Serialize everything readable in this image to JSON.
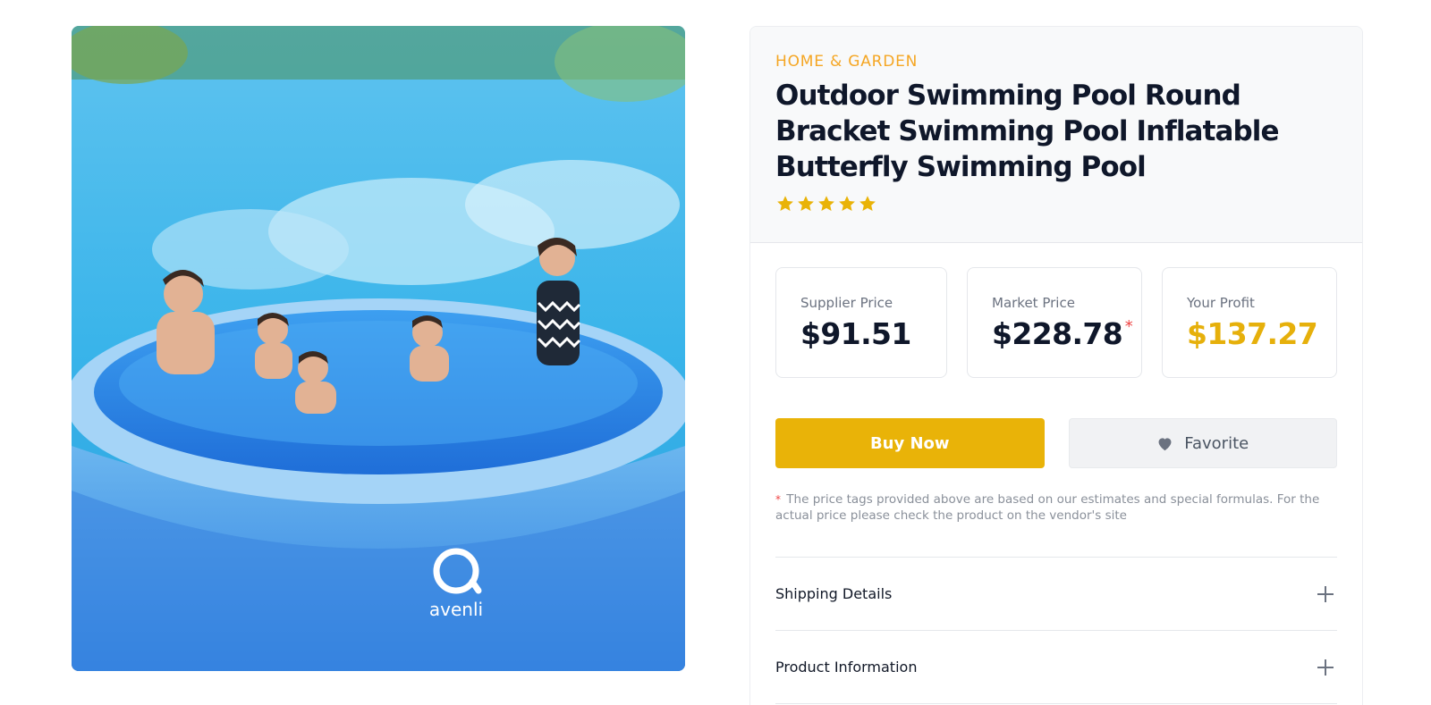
{
  "product": {
    "category": "HOME & GARDEN",
    "title": "Outdoor Swimming Pool Round Bracket Swimming Pool Inflatable Butterfly Swimming Pool",
    "rating": 5,
    "image_brand_logo": "avenli"
  },
  "prices": {
    "supplier_label": "Supplier Price",
    "supplier_value": "$91.51",
    "market_label": "Market Price",
    "market_value": "$228.78",
    "market_asterisk": "*",
    "profit_label": "Your Profit",
    "profit_value": "$137.27"
  },
  "actions": {
    "buy_label": "Buy Now",
    "favorite_label": "Favorite"
  },
  "disclaimer": {
    "marker": "*",
    "text": "The price tags provided above are based on our estimates and special formulas. For the actual price please check the product on the vendor's site"
  },
  "accordion": [
    {
      "label": "Shipping Details"
    },
    {
      "label": "Product Information"
    }
  ],
  "colors": {
    "accent": "#e9b308",
    "category": "#f5a623",
    "profit": "#e6b00b",
    "asterisk": "#ef4444"
  },
  "icons": {
    "star": "star-icon",
    "heart": "heart-icon",
    "expand": "plus-icon"
  }
}
